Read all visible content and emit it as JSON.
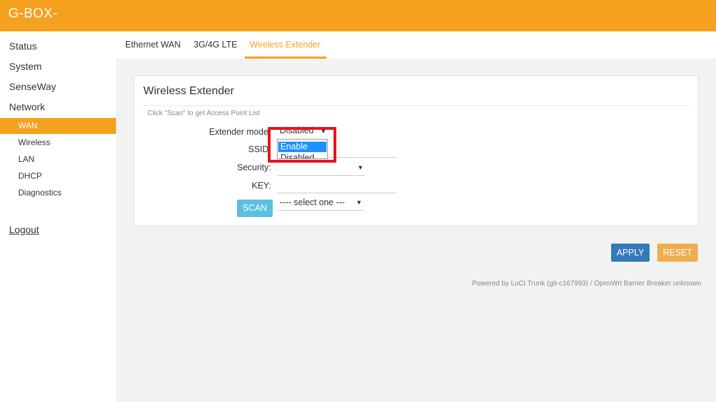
{
  "app": {
    "brand": "G-BOX-"
  },
  "sidebar": {
    "items": [
      {
        "label": "Status"
      },
      {
        "label": "System"
      },
      {
        "label": "SenseWay"
      },
      {
        "label": "Network"
      }
    ],
    "subitems": [
      {
        "label": "WAN",
        "active": true
      },
      {
        "label": "Wireless"
      },
      {
        "label": "LAN"
      },
      {
        "label": "DHCP"
      },
      {
        "label": "Diagnostics"
      }
    ],
    "logout": "Logout"
  },
  "tabs": [
    {
      "label": "Ethernet WAN"
    },
    {
      "label": "3G/4G LTE"
    },
    {
      "label": "Wireless Extender",
      "active": true
    }
  ],
  "panel": {
    "title": "Wireless Extender",
    "hint": "Click \"Scan\" to get Access Point List",
    "fields": {
      "extender_mode": {
        "label": "Extender mode:",
        "value": "Disabled"
      },
      "ssid": {
        "label": "SSID:",
        "value": ""
      },
      "security": {
        "label": "Security:",
        "value": ""
      },
      "key": {
        "label": "KEY:",
        "value": ""
      },
      "ap_list": {
        "value": "---- select one ---"
      }
    },
    "scan_label": "SCAN",
    "dropdown_options": [
      {
        "label": "Enable",
        "selected": true
      },
      {
        "label": "Disabled"
      }
    ]
  },
  "actions": {
    "apply": "APPLY",
    "reset": "RESET"
  },
  "footer": "Powered by LuCI Trunk (git-c167993) / OpenWrt Barrier Breaker unknown",
  "colors": {
    "accent": "#f5a11f",
    "scan": "#5bc0de",
    "apply": "#337ab7",
    "reset": "#f0ad4e",
    "highlight": "#e8131f",
    "selection": "#1e90ff"
  }
}
